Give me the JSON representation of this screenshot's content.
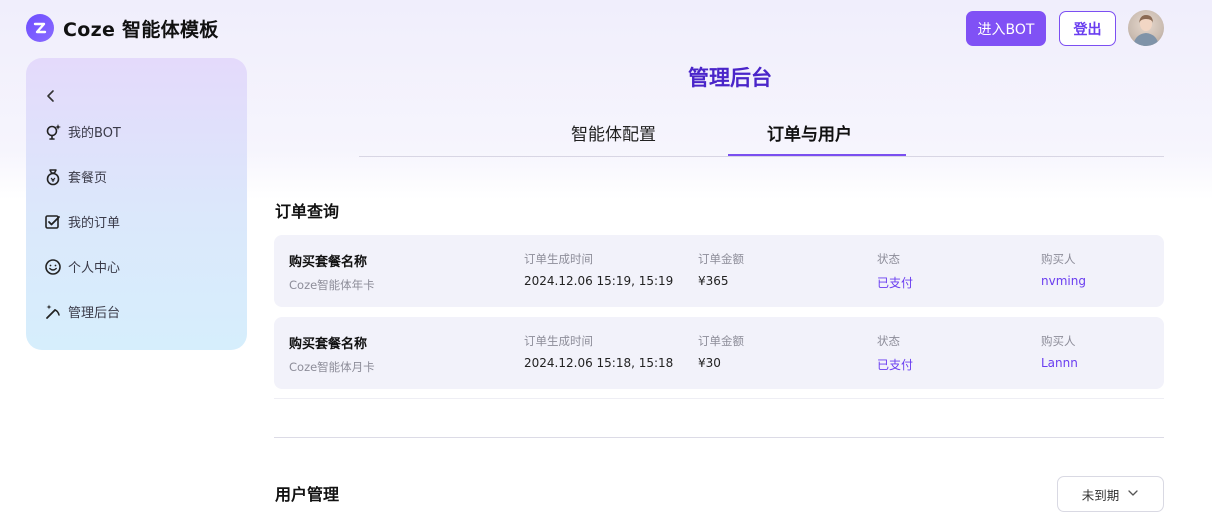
{
  "header": {
    "logo_text": "Coze 智能体模板",
    "enter_bot_label": "进入BOT",
    "logout_label": "登出"
  },
  "sidebar": {
    "items": [
      {
        "label": "我的BOT",
        "icon": "bulb-sparkle-icon"
      },
      {
        "label": "套餐页",
        "icon": "money-bag-icon"
      },
      {
        "label": "我的订单",
        "icon": "order-check-icon"
      },
      {
        "label": "个人中心",
        "icon": "smile-icon"
      },
      {
        "label": "管理后台",
        "icon": "magic-wand-icon"
      }
    ]
  },
  "main": {
    "title": "管理后台",
    "tabs": [
      {
        "label": "智能体配置",
        "active": false
      },
      {
        "label": "订单与用户",
        "active": true
      }
    ],
    "orders_section_title": "订单查询",
    "order_columns": {
      "plan": "购买套餐名称",
      "time": "订单生成时间",
      "amount": "订单金额",
      "status": "状态",
      "buyer": "购买人"
    },
    "orders": [
      {
        "plan": "Coze智能体年卡",
        "time": "2024.12.06 15:19, 15:19",
        "amount": "¥365",
        "status": "已支付",
        "buyer": "nvming"
      },
      {
        "plan": "Coze智能体月卡",
        "time": "2024.12.06 15:18, 15:18",
        "amount": "¥30",
        "status": "已支付",
        "buyer": "Lannn"
      }
    ],
    "users_section_title": "用户管理",
    "user_filter": {
      "selected": "未到期"
    }
  },
  "colors": {
    "accent": "#8051f5",
    "title": "#4a25c9",
    "status": "#6a3df0"
  }
}
